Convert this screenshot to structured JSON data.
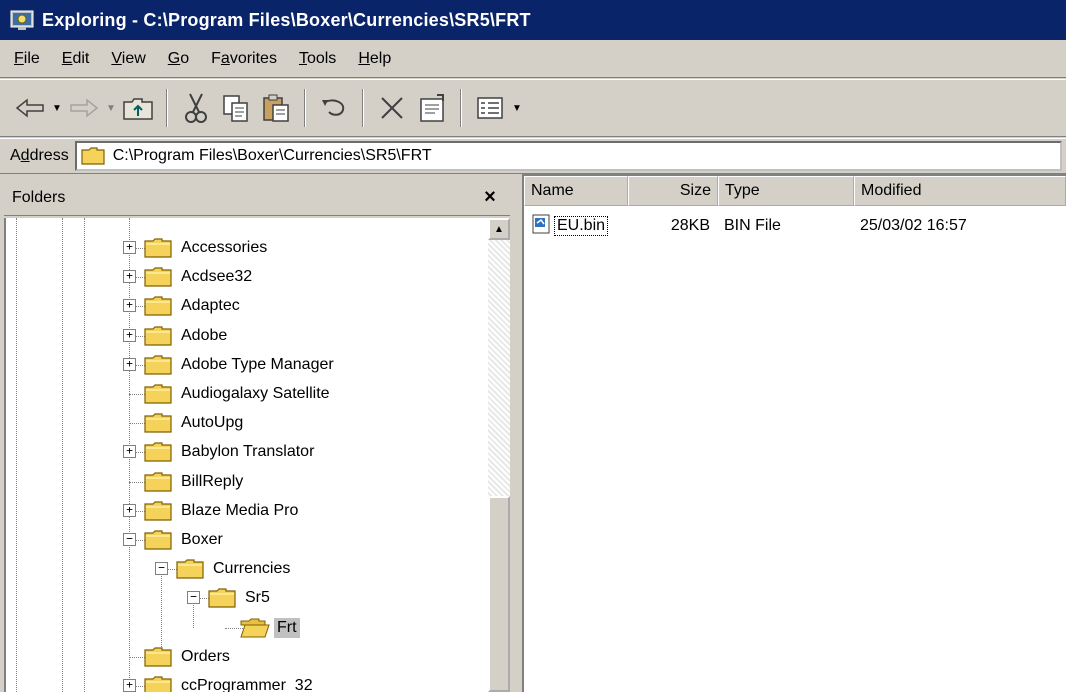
{
  "window": {
    "title": "Exploring - C:\\Program Files\\Boxer\\Currencies\\SR5\\FRT"
  },
  "menu": [
    {
      "label": "File",
      "ul": "F",
      "rest": "ile"
    },
    {
      "label": "Edit",
      "ul": "E",
      "rest": "dit"
    },
    {
      "label": "View",
      "ul": "V",
      "rest": "iew"
    },
    {
      "label": "Go",
      "ul": "G",
      "rest": "o"
    },
    {
      "label": "Favorites",
      "pre": "F",
      "ul": "a",
      "rest": "vorites"
    },
    {
      "label": "Tools",
      "ul": "T",
      "rest": "ools"
    },
    {
      "label": "Help",
      "ul": "H",
      "rest": "elp"
    }
  ],
  "address": {
    "label": "Address",
    "label_pre": "A",
    "label_ul": "d",
    "label_rest": "dress",
    "value": "C:\\Program Files\\Boxer\\Currencies\\SR5\\FRT"
  },
  "folders": {
    "title": "Folders",
    "close": "×",
    "items": [
      {
        "label": "Accessories",
        "expander": "+"
      },
      {
        "label": "Acdsee32",
        "expander": "+"
      },
      {
        "label": "Adaptec",
        "expander": "+"
      },
      {
        "label": "Adobe",
        "expander": "+"
      },
      {
        "label": "Adobe Type Manager",
        "expander": "+"
      },
      {
        "label": "Audiogalaxy Satellite",
        "expander": ""
      },
      {
        "label": "AutoUpg",
        "expander": ""
      },
      {
        "label": "Babylon Translator",
        "expander": "+"
      },
      {
        "label": "BillReply",
        "expander": ""
      },
      {
        "label": "Blaze Media Pro",
        "expander": "+"
      },
      {
        "label": "Boxer",
        "expander": "−"
      },
      {
        "label": "Currencies",
        "expander": "−"
      },
      {
        "label": "Sr5",
        "expander": "−"
      },
      {
        "label": "Frt",
        "expander": "",
        "selected": true
      },
      {
        "label": "Orders",
        "expander": ""
      },
      {
        "label": "ccProgrammer_32",
        "expander": "+"
      }
    ]
  },
  "list": {
    "columns": {
      "name": "Name",
      "size": "Size",
      "type": "Type",
      "modified": "Modified"
    },
    "files": [
      {
        "name": "EU.bin",
        "size": "28KB",
        "type": "BIN File",
        "modified": "25/03/02 16:57"
      }
    ]
  },
  "colors": {
    "titlebar": "#0a246a",
    "chrome": "#d4d0c8",
    "folder": "#f5d35a"
  }
}
